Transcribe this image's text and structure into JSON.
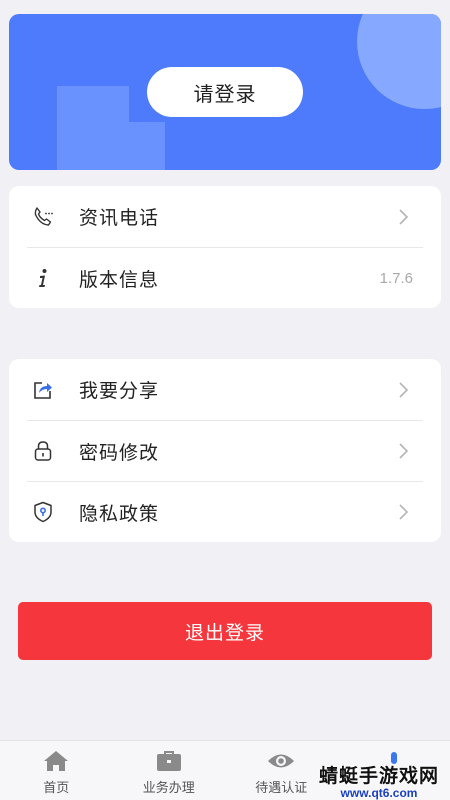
{
  "banner": {
    "login_label": "请登录"
  },
  "group1": {
    "items": [
      {
        "label": "资讯电话",
        "icon": "phone-icon"
      },
      {
        "label": "版本信息",
        "icon": "info-icon",
        "value": "1.7.6"
      }
    ]
  },
  "group2": {
    "items": [
      {
        "label": "我要分享",
        "icon": "share-icon"
      },
      {
        "label": "密码修改",
        "icon": "lock-icon"
      },
      {
        "label": "隐私政策",
        "icon": "shield-icon"
      }
    ]
  },
  "logout_label": "退出登录",
  "tabbar": {
    "tabs": [
      {
        "label": "首页",
        "icon": "home-icon"
      },
      {
        "label": "业务办理",
        "icon": "briefcase-icon"
      },
      {
        "label": "待遇认证",
        "icon": "eye-icon"
      },
      {
        "label": "",
        "icon": "person-icon"
      }
    ]
  },
  "watermark": {
    "title": "蜻蜓手游戏网",
    "url": "www.qt6.com"
  },
  "colors": {
    "accent": "#4d7bfb",
    "danger": "#f5373d",
    "active_tab": "#3b78f0"
  }
}
